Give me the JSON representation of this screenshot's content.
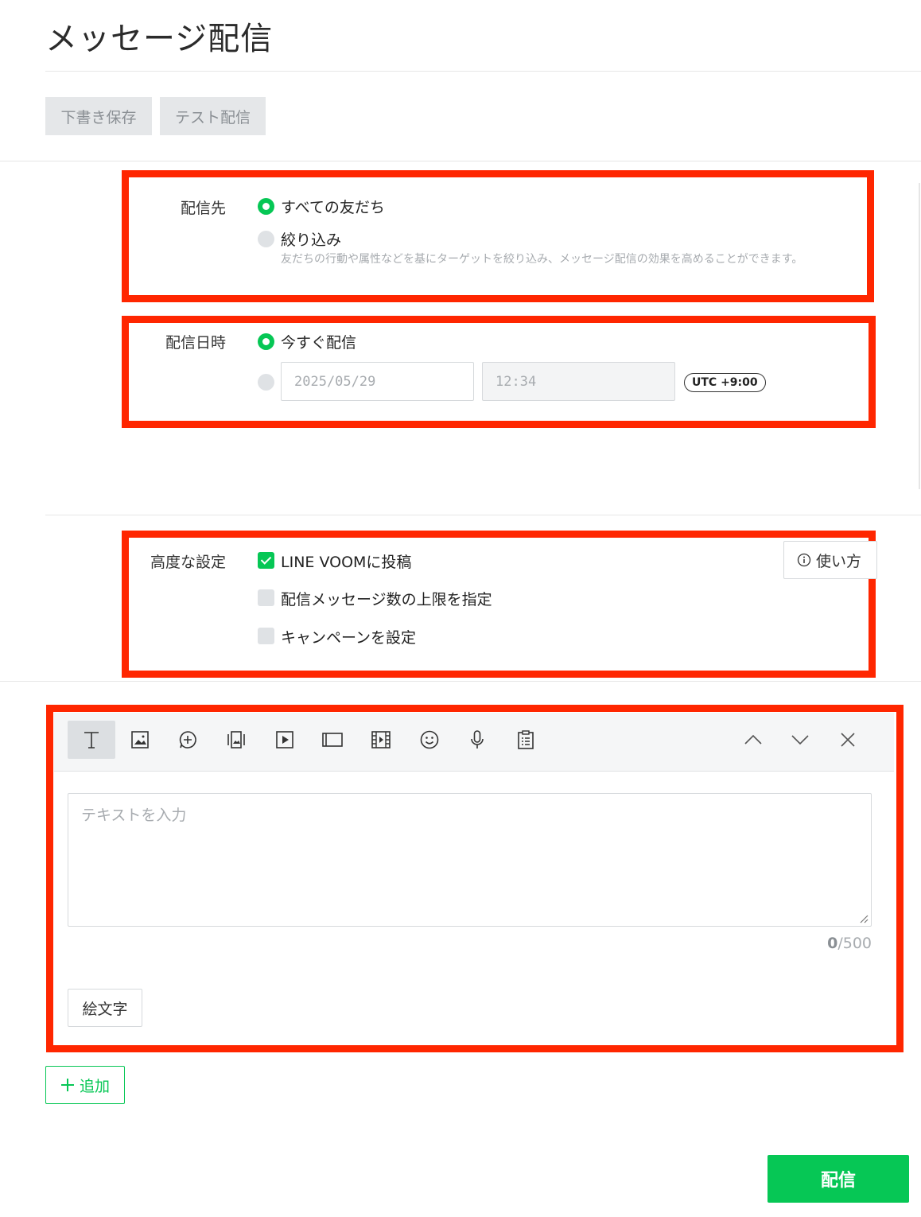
{
  "page": {
    "title": "メッセージ配信"
  },
  "toolbar": {
    "draft_save": "下書き保存",
    "test_send": "テスト配信"
  },
  "recipients": {
    "label": "配信先",
    "option_all": "すべての友だち",
    "option_filter": "絞り込み",
    "filter_help": "友だちの行動や属性などを基にターゲットを絞り込み、メッセージ配信の効果を高めることができます。",
    "selected": "all"
  },
  "schedule": {
    "label": "配信日時",
    "option_now": "今すぐ配信",
    "date_value": "2025/05/29",
    "time_value": "12:34",
    "timezone": "UTC +9:00",
    "selected": "now"
  },
  "advanced": {
    "label": "高度な設定",
    "howto_label": "使い方",
    "options": [
      {
        "label": "LINE VOOMに投稿",
        "checked": true
      },
      {
        "label": "配信メッセージ数の上限を指定",
        "checked": false
      },
      {
        "label": "キャンペーンを設定",
        "checked": false
      }
    ]
  },
  "editor": {
    "tools": [
      "text-icon",
      "image-icon",
      "stamp-icon",
      "card-message-icon",
      "video-icon",
      "rich-message-icon",
      "rich-video-icon",
      "emoji-icon",
      "voice-icon",
      "survey-icon"
    ],
    "placeholder": "テキストを入力",
    "count_current": "0",
    "count_max": "/500",
    "emoji_button": "絵文字"
  },
  "actions": {
    "add_label": "追加",
    "send_label": "配信"
  },
  "colors": {
    "accent": "#06c755",
    "highlight": "#ff2600"
  }
}
